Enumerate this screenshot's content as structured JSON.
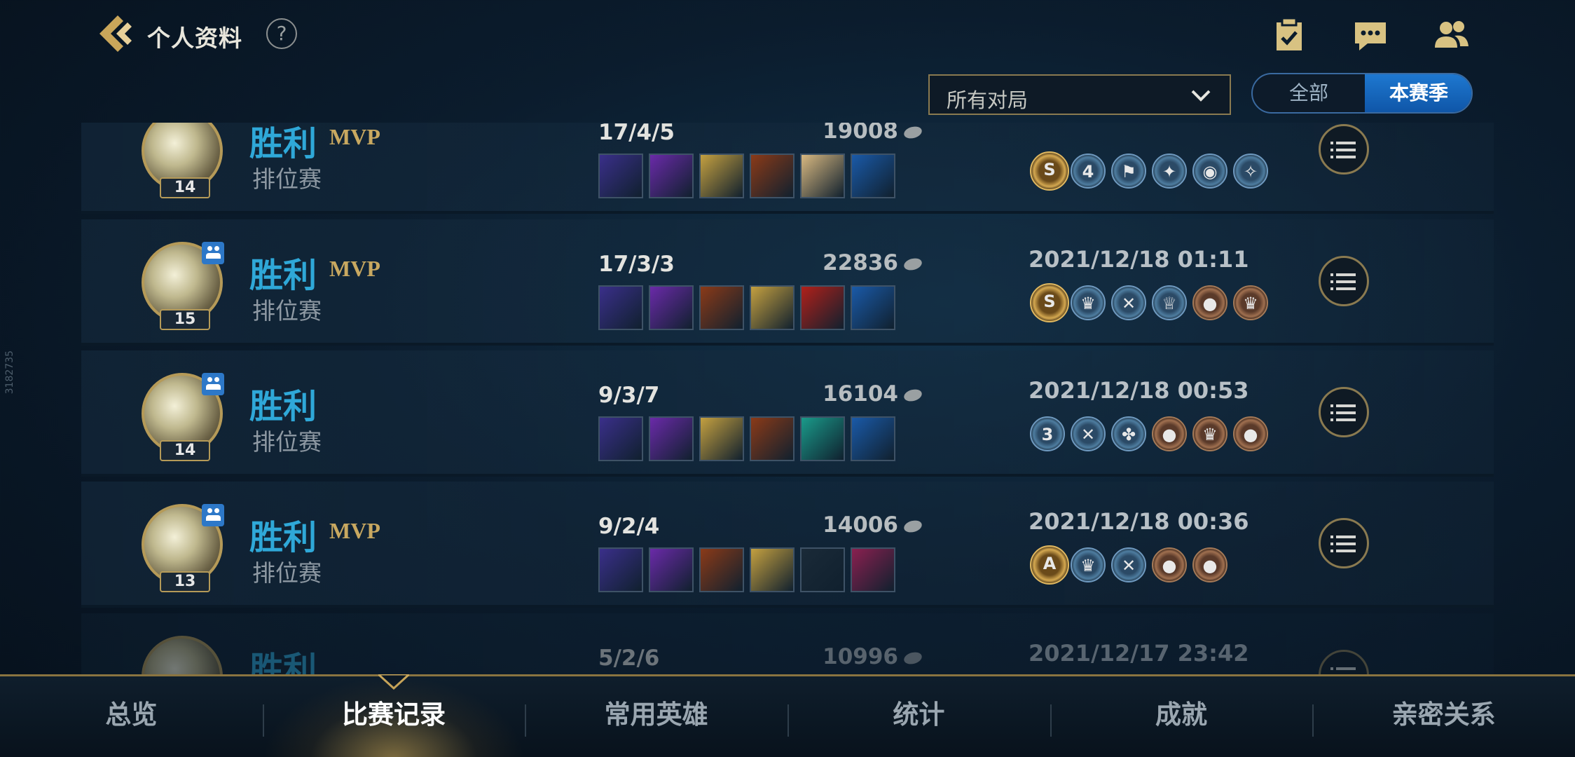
{
  "watermark": "3182735",
  "header": {
    "title": "个人资料",
    "help_label": "?",
    "icons": [
      "checklist-icon",
      "chat-icon",
      "friends-icon"
    ]
  },
  "filter": {
    "dropdown_value": "所有对局",
    "segments": [
      "全部",
      "本赛季"
    ],
    "selected_segment": "本赛季"
  },
  "matches": [
    {
      "result": "胜利",
      "mvp": "MVP",
      "mode": "排位赛",
      "level": "14",
      "kda": "17/4/5",
      "gold": "19008",
      "time": "",
      "team": false,
      "items": [
        "#3a2f8a",
        "#6a2aa8",
        "#c4a040",
        "#8a3a18",
        "#d8b880",
        "#1a5aa8"
      ],
      "badges": [
        {
          "t": "gold",
          "l": "S"
        },
        {
          "t": "blue",
          "l": "4"
        },
        {
          "t": "blue",
          "l": "⚑"
        },
        {
          "t": "blue",
          "l": "✦"
        },
        {
          "t": "blue",
          "l": "◉"
        },
        {
          "t": "blue",
          "l": "✧"
        }
      ]
    },
    {
      "result": "胜利",
      "mvp": "MVP",
      "mode": "排位赛",
      "level": "15",
      "kda": "17/3/3",
      "gold": "22836",
      "time": "2021/12/18 01:11",
      "team": true,
      "items": [
        "#3a2f8a",
        "#6a2aa8",
        "#8a3a18",
        "#c4a040",
        "#b0201a",
        "#1a5aa8"
      ],
      "badges": [
        {
          "t": "gold",
          "l": "S"
        },
        {
          "t": "blue",
          "l": "♛"
        },
        {
          "t": "blue",
          "l": "✕"
        },
        {
          "t": "blue",
          "l": "♕"
        },
        {
          "t": "bronze",
          "l": "●"
        },
        {
          "t": "bronze",
          "l": "♛"
        }
      ]
    },
    {
      "result": "胜利",
      "mvp": "",
      "mode": "排位赛",
      "level": "14",
      "kda": "9/3/7",
      "gold": "16104",
      "time": "2021/12/18 00:53",
      "team": true,
      "items": [
        "#3a2f8a",
        "#6a2aa8",
        "#c4a040",
        "#8a3a18",
        "#1a9a8a",
        "#1a5aa8"
      ],
      "badges": [
        {
          "t": "blue",
          "l": "3"
        },
        {
          "t": "blue",
          "l": "✕"
        },
        {
          "t": "blue",
          "l": "✤"
        },
        {
          "t": "bronze",
          "l": "●"
        },
        {
          "t": "bronze",
          "l": "♛"
        },
        {
          "t": "bronze",
          "l": "●"
        }
      ]
    },
    {
      "result": "胜利",
      "mvp": "MVP",
      "mode": "排位赛",
      "level": "13",
      "kda": "9/2/4",
      "gold": "14006",
      "time": "2021/12/18 00:36",
      "team": true,
      "items": [
        "#3a2f8a",
        "#6a2aa8",
        "#8a3a18",
        "#c4a040",
        "#1a2a38",
        "#8a2050"
      ],
      "badges": [
        {
          "t": "gold",
          "l": "A"
        },
        {
          "t": "blue",
          "l": "♛"
        },
        {
          "t": "blue",
          "l": "✕"
        },
        {
          "t": "bronze",
          "l": "●"
        },
        {
          "t": "bronze",
          "l": "●"
        }
      ]
    },
    {
      "result": "胜利",
      "mvp": "",
      "mode": "",
      "level": "",
      "kda": "5/2/6",
      "gold": "10996",
      "time": "2021/12/17 23:42",
      "team": false,
      "items": [],
      "badges": []
    }
  ],
  "tabs": [
    "总览",
    "比赛记录",
    "常用英雄",
    "统计",
    "成就",
    "亲密关系"
  ],
  "active_tab": "比赛记录"
}
